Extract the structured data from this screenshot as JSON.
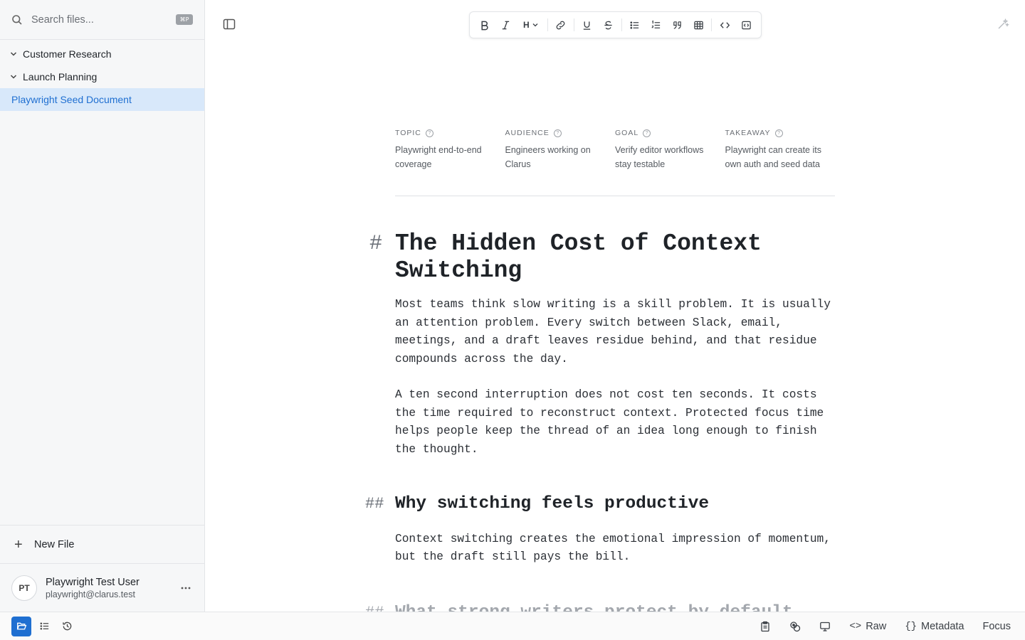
{
  "sidebar": {
    "search": {
      "placeholder": "Search files...",
      "shortcut": "⌘P"
    },
    "folders": [
      {
        "label": "Customer Research"
      },
      {
        "label": "Launch Planning"
      }
    ],
    "active_file": {
      "label": "Playwright Seed Document"
    },
    "new_file_label": "New File",
    "user": {
      "initials": "PT",
      "name": "Playwright Test User",
      "email": "playwright@clarus.test"
    }
  },
  "toolbar": {
    "heading_label": "H",
    "buttons": [
      "bold",
      "italic",
      "heading",
      "link",
      "underline",
      "strikethrough",
      "bullet-list",
      "numbered-list",
      "quote",
      "table",
      "code",
      "code-block"
    ]
  },
  "metadata": [
    {
      "label": "TOPIC",
      "value": "Playwright end-to-end coverage"
    },
    {
      "label": "AUDIENCE",
      "value": "Engineers working on Clarus"
    },
    {
      "label": "GOAL",
      "value": "Verify editor workflows stay testable"
    },
    {
      "label": "TAKEAWAY",
      "value": "Playwright can create its own auth and seed data"
    }
  ],
  "document": {
    "h1_mark": "#",
    "h2_mark": "##",
    "title": "The Hidden Cost of Context Switching",
    "paragraphs": [
      "Most teams think slow writing is a skill problem. It is usually an attention problem. Every switch between Slack, email, meetings, and a draft leaves residue behind, and that residue compounds across the day.",
      "A ten second interruption does not cost ten seconds. It costs the time required to reconstruct context. Protected focus time helps people keep the thread of an idea long enough to finish the thought."
    ],
    "section1": {
      "heading": "Why switching feels productive",
      "paragraph": "Context switching creates the emotional impression of momentum, but the draft still pays the bill."
    },
    "section2": {
      "heading": "What strong writers protect by default"
    }
  },
  "statusbar": {
    "raw_label": "Raw",
    "raw_prefix": "<>",
    "metadata_label": "Metadata",
    "metadata_prefix": "{}",
    "focus_label": "Focus"
  },
  "colors": {
    "accent": "#1f6fd1",
    "selected_bg": "#d8e8fa",
    "sidebar_bg": "#f6f7f8"
  }
}
